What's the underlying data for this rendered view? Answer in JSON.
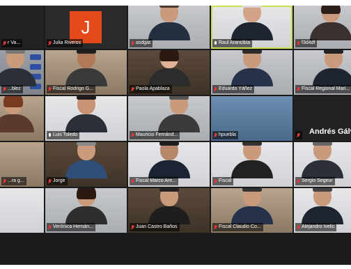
{
  "participants": [
    {
      "id": "r0c0",
      "name": "r Va...",
      "muted": true
    },
    {
      "id": "r0c1",
      "name": "Julia Riveros",
      "muted": true,
      "avatar_letter": "J"
    },
    {
      "id": "r0c2",
      "name": "asdgat",
      "muted": true
    },
    {
      "id": "r0c3",
      "name": "Raul Arancibia",
      "muted": false,
      "speaking": true
    },
    {
      "id": "r0c4",
      "name": "f3d4df",
      "muted": true
    },
    {
      "id": "r1c0",
      "name": "...blez",
      "muted": true
    },
    {
      "id": "r1c1",
      "name": "Fiscal Rodrigo G...",
      "muted": true
    },
    {
      "id": "r1c2",
      "name": "Paola Apablaza",
      "muted": true
    },
    {
      "id": "r1c3",
      "name": "Eduardo Yáñez",
      "muted": true
    },
    {
      "id": "r1c4",
      "name": "Fiscal Regional Mari...",
      "muted": true
    },
    {
      "id": "r2c0",
      "name": "...",
      "muted": true
    },
    {
      "id": "r2c1",
      "name": "Luis Toledo",
      "muted": false
    },
    {
      "id": "r2c2",
      "name": "Mauricio Fernánd...",
      "muted": true
    },
    {
      "id": "r2c3",
      "name": "hpuebla",
      "muted": true
    },
    {
      "id": "r2c4",
      "name": "",
      "muted": true,
      "display_name": "Andrés Gálv"
    },
    {
      "id": "r3c0",
      "name": "...ra g...",
      "muted": true
    },
    {
      "id": "r3c1",
      "name": "Jorge",
      "muted": true
    },
    {
      "id": "r3c2",
      "name": "Fiscal Marco Are...",
      "muted": true
    },
    {
      "id": "r3c3",
      "name": "Fiscal",
      "muted": true
    },
    {
      "id": "r3c4",
      "name": "Sergio Segeur",
      "muted": true
    },
    {
      "id": "r4c0",
      "name": "",
      "muted": false
    },
    {
      "id": "r4c1",
      "name": "Verónica Hernán...",
      "muted": true
    },
    {
      "id": "r4c2",
      "name": "Juan Castro Baños",
      "muted": true
    },
    {
      "id": "r4c3",
      "name": "Fiscal Claudio Co...",
      "muted": true
    },
    {
      "id": "r4c4",
      "name": "Alejandro Ivelic",
      "muted": true
    }
  ],
  "colors": {
    "active_border": "#c8e04a",
    "avatar_bg": "#e3491b",
    "muted_mic": "#e53935"
  }
}
